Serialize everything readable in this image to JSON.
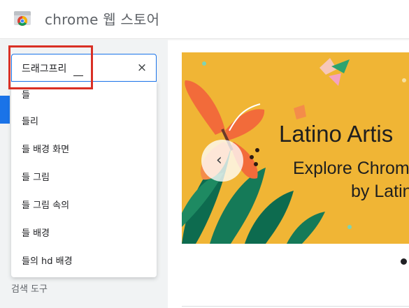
{
  "header": {
    "title": "chrome 웹 스토어",
    "logo_icon": "chrome-logo-icon"
  },
  "search": {
    "value": "드래그프리",
    "clear_icon": "close-icon",
    "clear_glyph": "×"
  },
  "suggestions": [
    "들",
    "들리",
    "들 배경 화면",
    "들 그림",
    "들 그림 속의",
    "들 배경",
    "들의 hd 배경"
  ],
  "sidebar": {
    "search_tools_label": "검색 도구"
  },
  "banner": {
    "title": "Latino Artis",
    "subtitle_line1": "Explore Chrom",
    "subtitle_line2": "by Latin",
    "prev_glyph": "‹",
    "prev_icon": "chevron-left-icon",
    "background_color": "#f0b535"
  },
  "colors": {
    "accent": "#1a73e8",
    "highlight": "#d93025",
    "sidebar_bg": "#f1f3f4"
  }
}
